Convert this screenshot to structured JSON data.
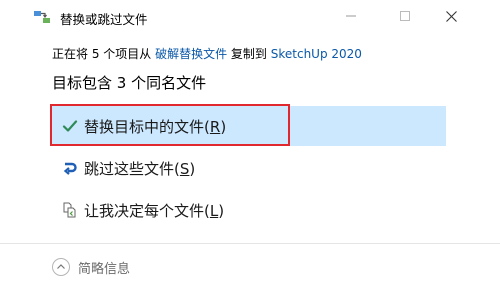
{
  "window": {
    "title": "替换或跳过文件",
    "icon": "file-transfer-icon"
  },
  "progress": {
    "copy_prefix": "正在将 5 个项目从 ",
    "source": "破解替换文件",
    "copy_middle": " 复制到 ",
    "destination": "SketchUp 2020"
  },
  "heading": "目标包含 3 个同名文件",
  "options": [
    {
      "label": "替换目标中的文件",
      "accel_open": "(",
      "accel_key": "R",
      "accel_close": ")",
      "icon": "checkmark-icon",
      "selected": true
    },
    {
      "label": "跳过这些文件",
      "accel_open": "(",
      "accel_key": "S",
      "accel_close": ")",
      "icon": "skip-arrow-icon",
      "selected": false
    },
    {
      "label": "让我决定每个文件",
      "accel_open": "(",
      "accel_key": "L",
      "accel_close": ")",
      "icon": "compare-files-icon",
      "selected": false
    }
  ],
  "footer": {
    "toggle_label": "简略信息"
  },
  "colors": {
    "selection_bg": "#cce8ff",
    "highlight_border": "#e0282e",
    "link": "#0a58a8",
    "check": "#2e8b57",
    "skip_arrow": "#1f5fb5"
  }
}
